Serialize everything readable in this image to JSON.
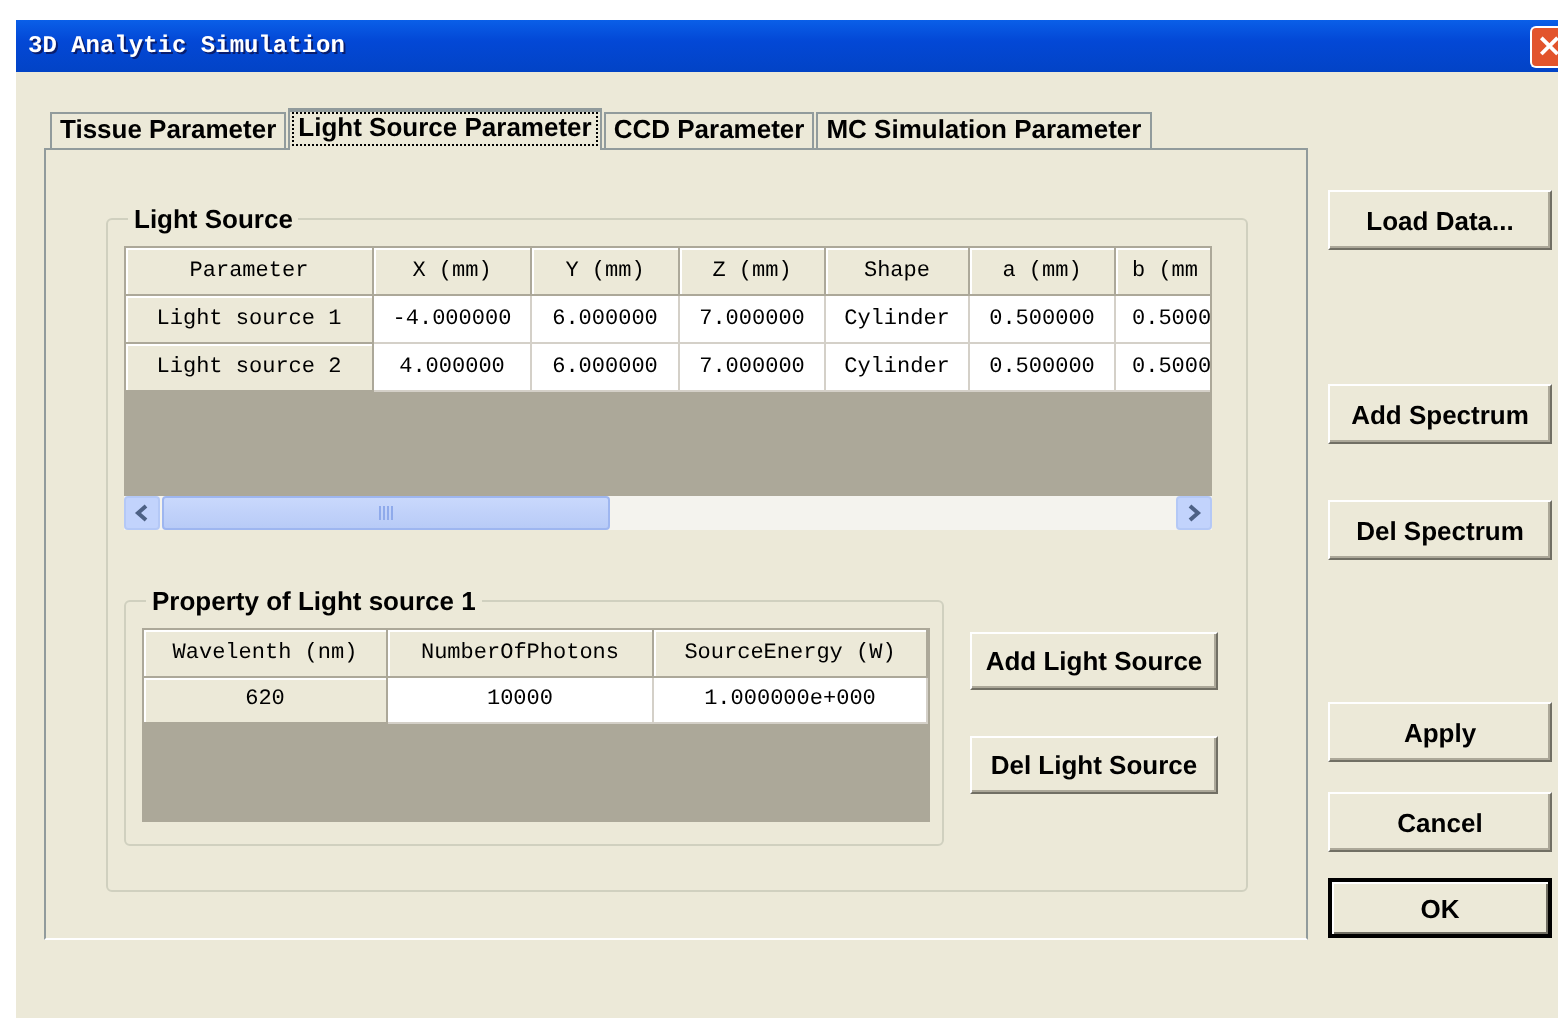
{
  "window": {
    "title": "3D Analytic Simulation",
    "close_label": "×"
  },
  "tabs": [
    {
      "label": "Tissue Parameter",
      "selected": false
    },
    {
      "label": "Light Source Parameter",
      "selected": true
    },
    {
      "label": "CCD Parameter",
      "selected": false
    },
    {
      "label": "MC Simulation Parameter",
      "selected": false
    }
  ],
  "light_source": {
    "title": "Light Source",
    "table": {
      "columns": [
        "Parameter",
        "X (mm)",
        "Y (mm)",
        "Z (mm)",
        "Shape",
        "a (mm)",
        "b (mm"
      ],
      "rows": [
        {
          "cells": [
            "Light source 1",
            "-4.000000",
            "6.000000",
            "7.000000",
            "Cylinder",
            "0.500000",
            "0.5000"
          ]
        },
        {
          "cells": [
            "Light source 2",
            "4.000000",
            "6.000000",
            "7.000000",
            "Cylinder",
            "0.500000",
            "0.5000"
          ]
        }
      ]
    },
    "property": {
      "title": "Property of Light source 1",
      "table": {
        "columns": [
          "Wavelenth (nm)",
          "NumberOfPhotons",
          "SourceEnergy (W)"
        ],
        "rows": [
          {
            "cells": [
              "620",
              "10000",
              "1.000000e+000"
            ]
          }
        ]
      }
    },
    "buttons": [
      "Add Light Source",
      "Del Light Source"
    ]
  },
  "side_buttons": [
    {
      "label": "Load Data...",
      "default": false
    },
    {
      "label": "Add Spectrum",
      "default": false
    },
    {
      "label": "Del Spectrum",
      "default": false
    },
    {
      "label": "Apply",
      "default": false
    },
    {
      "label": "Cancel",
      "default": false
    },
    {
      "label": "OK",
      "default": true
    }
  ]
}
